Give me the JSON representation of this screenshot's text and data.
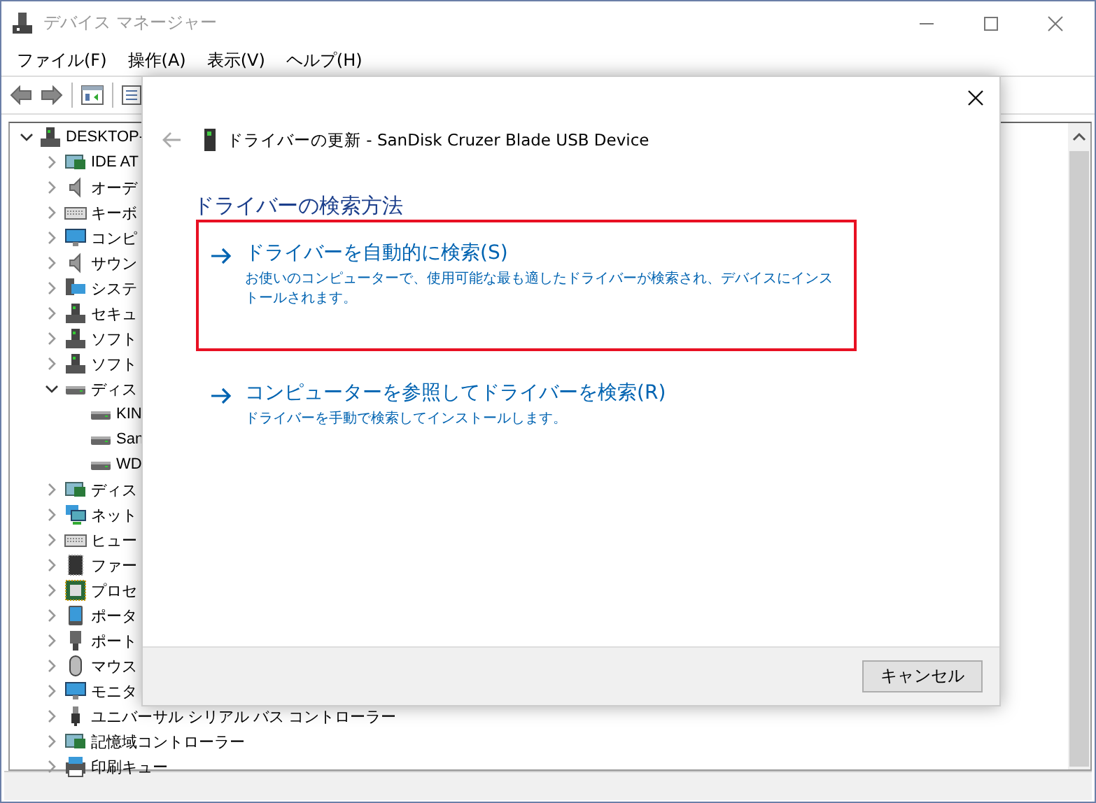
{
  "window": {
    "title": "デバイス マネージャー"
  },
  "menu": [
    "ファイル(F)",
    "操作(A)",
    "表示(V)",
    "ヘルプ(H)"
  ],
  "tree": {
    "label": "DESKTOP-",
    "expanded": true,
    "children": [
      {
        "label": "IDE AT",
        "expanded": false
      },
      {
        "label": "オーデ",
        "expanded": false
      },
      {
        "label": "キーボ",
        "expanded": false
      },
      {
        "label": "コンピ",
        "expanded": false
      },
      {
        "label": "サウン",
        "expanded": false
      },
      {
        "label": "システ",
        "expanded": false
      },
      {
        "label": "セキュ",
        "expanded": false
      },
      {
        "label": "ソフト",
        "expanded": false
      },
      {
        "label": "ソフト",
        "expanded": false
      },
      {
        "label": "ディス",
        "expanded": true,
        "children": [
          {
            "label": "KIN"
          },
          {
            "label": "San"
          },
          {
            "label": "WD"
          }
        ]
      },
      {
        "label": "ディス",
        "expanded": false
      },
      {
        "label": "ネット",
        "expanded": false
      },
      {
        "label": "ヒュー",
        "expanded": false
      },
      {
        "label": "ファー",
        "expanded": false
      },
      {
        "label": "プロセ",
        "expanded": false
      },
      {
        "label": "ポータ",
        "expanded": false
      },
      {
        "label": "ポート",
        "expanded": false
      },
      {
        "label": "マウス",
        "expanded": false
      },
      {
        "label": "モニタ",
        "expanded": false
      },
      {
        "label": "ユニバーサル シリアル バス コントローラー",
        "expanded": false
      },
      {
        "label": "記憶域コントローラー",
        "expanded": false
      },
      {
        "label": "印刷キュー",
        "expanded": false
      }
    ]
  },
  "dialog": {
    "title": "ドライバーの更新 - SanDisk Cruzer Blade USB Device",
    "heading": "ドライバーの検索方法",
    "options": [
      {
        "title": "ドライバーを自動的に検索(S)",
        "description": "お使いのコンピューターで、使用可能な最も適したドライバーが検索され、デバイスにインストールされます。",
        "highlighted": true
      },
      {
        "title": "コンピューターを参照してドライバーを検索(R)",
        "description": "ドライバーを手動で検索してインストールします。",
        "highlighted": false
      }
    ],
    "buttons": [
      "キャンセル"
    ]
  }
}
